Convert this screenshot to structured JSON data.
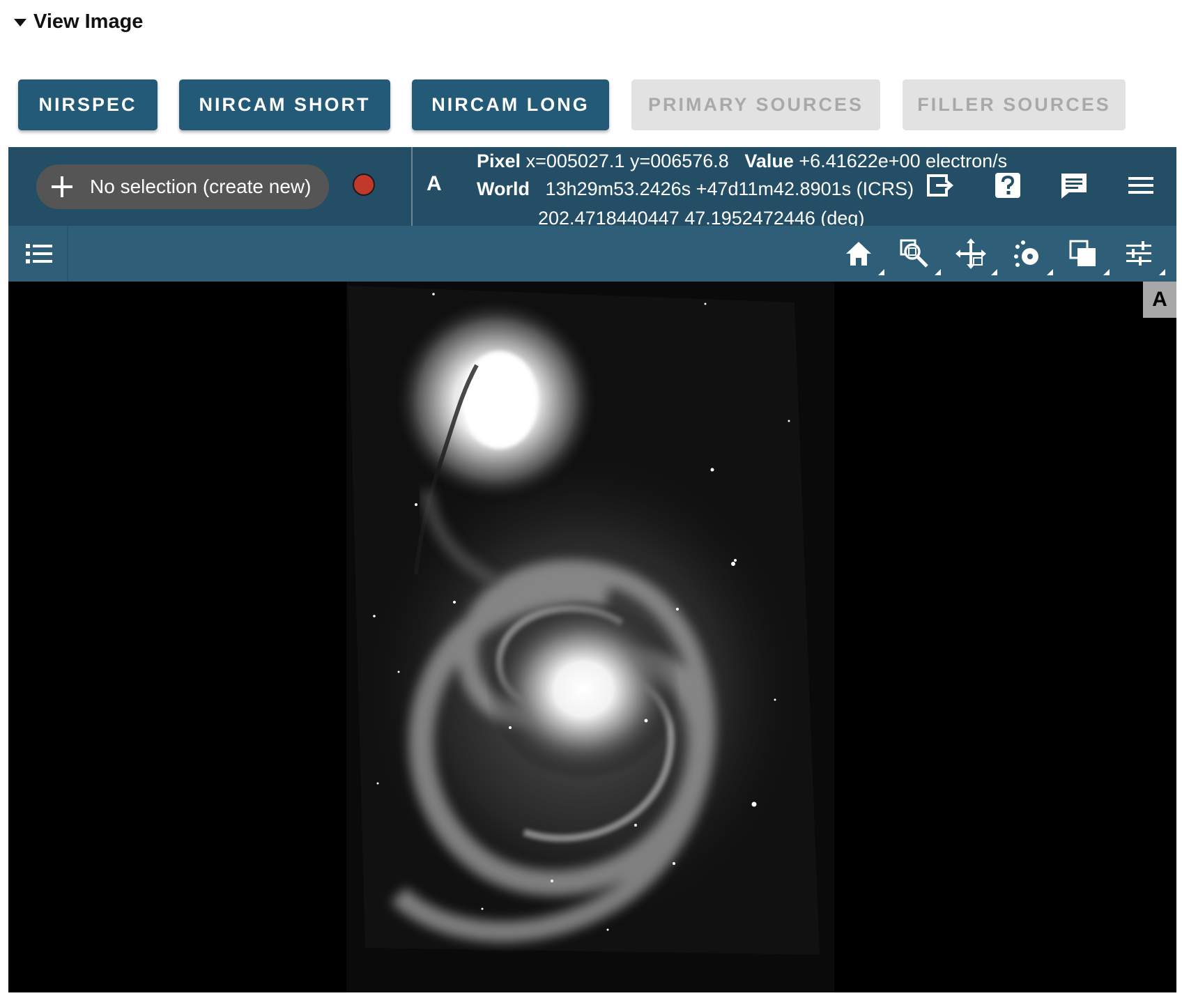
{
  "section": {
    "title": "View Image"
  },
  "buttons": [
    {
      "label": "NIRSPEC",
      "state": "active"
    },
    {
      "label": "NIRCAM SHORT",
      "state": "active"
    },
    {
      "label": "NIRCAM LONG",
      "state": "active"
    },
    {
      "label": "PRIMARY SOURCES",
      "state": "disabled"
    },
    {
      "label": "FILLER SOURCES",
      "state": "disabled"
    }
  ],
  "toolbar": {
    "selection_label": "No selection (create new)",
    "selection_color": "#c0392b",
    "viewer_letter": "A",
    "pixel_label": "Pixel",
    "pixel_value": "x=005027.1 y=006576.8",
    "value_label": "Value",
    "value_value": "+6.41622e+00 electron/s",
    "world_label": "World",
    "world_sexagesimal": "13h29m53.2426s +47d11m42.8901s (ICRS)",
    "world_degrees": "202.4718440447 47.1952472446 (deg)",
    "icons": [
      "export-icon",
      "help-icon",
      "feedback-icon",
      "menu-icon"
    ]
  },
  "tools": {
    "layers_icon": "layers-list-icon",
    "items": [
      "home-icon",
      "zoom-icon",
      "pan-icon",
      "spectrum-extraction-icon",
      "stretch-icon",
      "settings-icon"
    ]
  },
  "viewer": {
    "badge": "A",
    "image": "spiral-galaxy-m51"
  },
  "colors": {
    "active_button": "#225a78",
    "toolbar_top": "#244e66",
    "toolbar_second": "#2f5e78",
    "disabled_button": "#e2e2e2"
  }
}
